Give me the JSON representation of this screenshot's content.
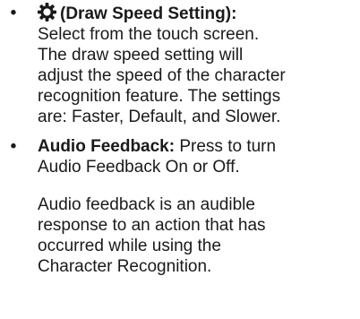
{
  "items": [
    {
      "bullet": "•",
      "icon": "gear-icon",
      "term": "(Draw Speed Setting):",
      "lines": [
        "Select from the touch screen.",
        "The draw speed setting will",
        "adjust the speed of the character",
        "recognition feature. The settings",
        "are: Faster, Default, and Slower."
      ]
    },
    {
      "bullet": "•",
      "term": "Audio Feedback:",
      "first_line_rest": " Press to turn",
      "lines": [
        "Audio Feedback On or Off."
      ]
    }
  ],
  "note_lines": [
    "Audio feedback is an audible",
    "response to an action that has",
    "occurred while using the",
    "Character Recognition."
  ]
}
